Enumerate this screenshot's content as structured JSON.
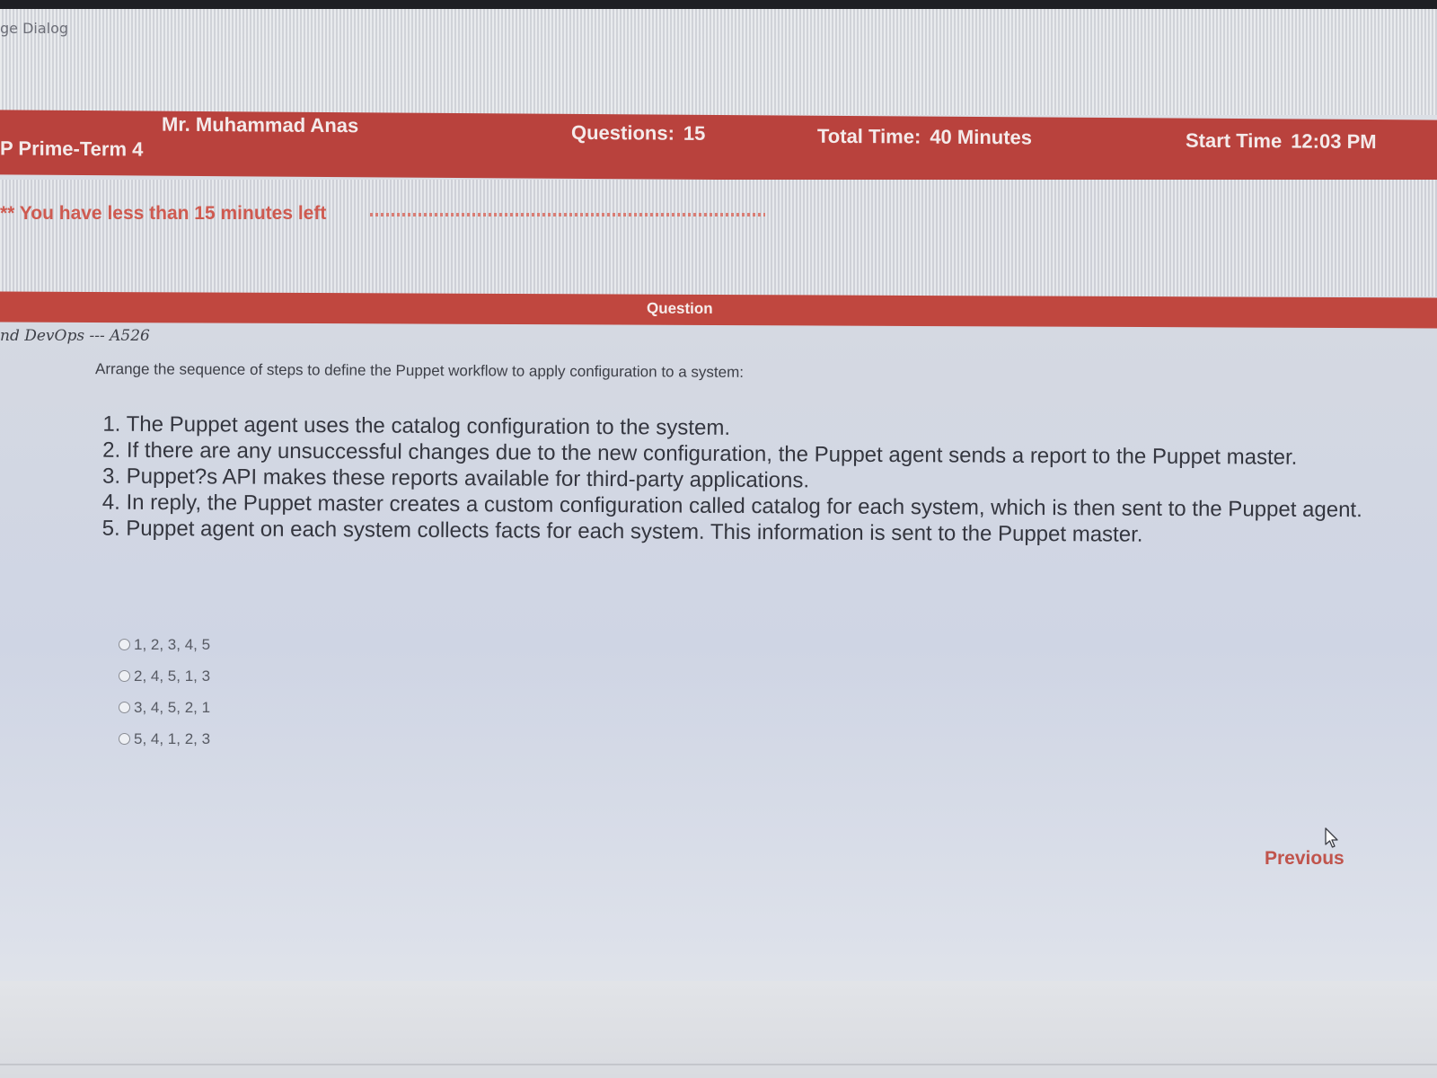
{
  "window": {
    "title": "ge Dialog"
  },
  "header": {
    "teacher": "Mr. Muhammad Anas",
    "course": "P Prime-Term 4",
    "questions_label": "Questions:",
    "questions_value": "15",
    "total_time_label": "Total Time:",
    "total_time_value": "40 Minutes",
    "start_time_label": "Start Time",
    "start_time_value": "12:03 PM"
  },
  "warning": {
    "text": "** You have less than 15 minutes left"
  },
  "question_bar": {
    "label": "Question"
  },
  "question": {
    "course_code": "nd DevOps --- A526",
    "prompt": "Arrange the sequence of steps to define the Puppet workflow to apply configuration to a system:",
    "steps": [
      "1. The Puppet agent uses the catalog configuration to the system.",
      "2. If there are any unsuccessful changes due to the new configuration, the Puppet agent sends a report to the Puppet master.",
      "3. Puppet?s API makes these reports available for third-party applications.",
      "4. In reply, the Puppet master creates a custom configuration called catalog for each system, which is then sent to the Puppet agent.",
      "5. Puppet agent on each system collects facts for each system. This information is sent to the Puppet master."
    ],
    "options": [
      {
        "label": "1, 2, 3, 4, 5"
      },
      {
        "label": "2, 4, 5, 1, 3"
      },
      {
        "label": "3, 4, 5, 2, 1"
      },
      {
        "label": "5, 4, 1, 2, 3"
      }
    ]
  },
  "nav": {
    "previous_label": "Previous"
  },
  "colors": {
    "header_red": "#b9423d",
    "question_bar_red": "#c0473f",
    "warning_text": "#cf5a50",
    "link_red": "#c0544c"
  },
  "icons": {
    "cursor": "mouse-pointer-icon"
  }
}
